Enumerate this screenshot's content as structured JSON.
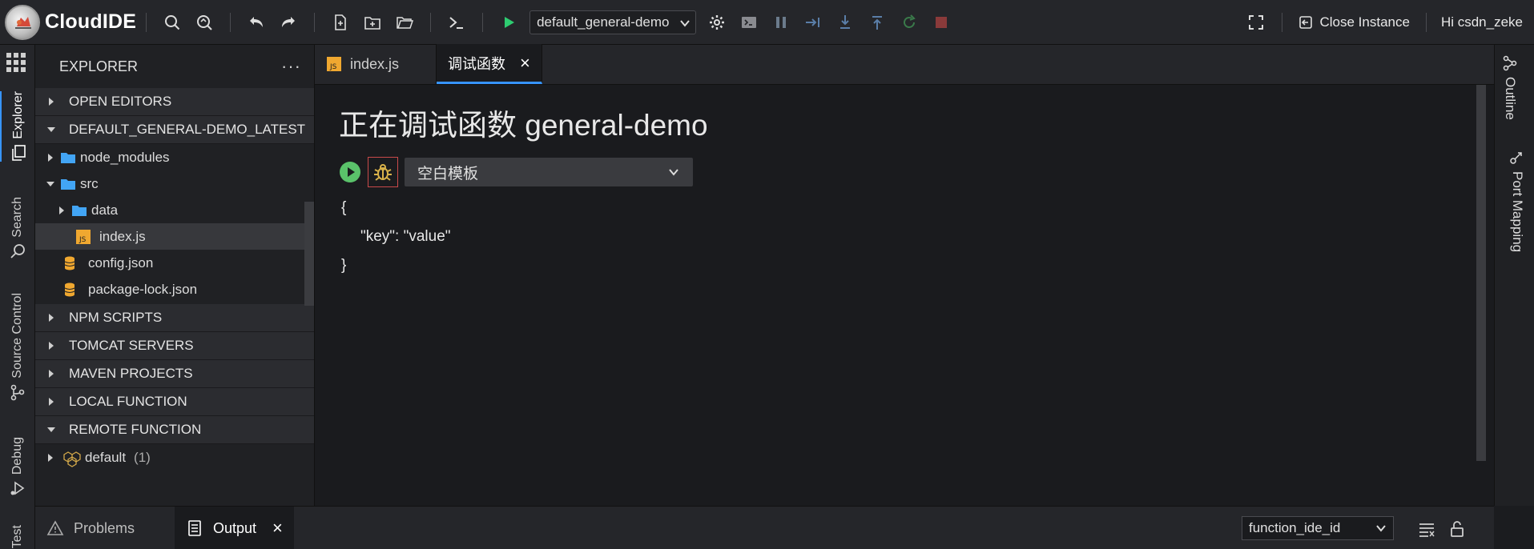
{
  "app": {
    "name": "CloudIDE"
  },
  "toolbar": {
    "launch_config": "default_general-demo",
    "close_instance": "Close Instance",
    "greeting": "Hi csdn_zeke"
  },
  "activity_bar": {
    "items": [
      {
        "label": "Explorer"
      },
      {
        "label": "Search"
      },
      {
        "label": "Source Control"
      },
      {
        "label": "Debug"
      },
      {
        "label": "Test"
      }
    ]
  },
  "explorer": {
    "title": "EXPLORER",
    "more": "···",
    "sections": {
      "open_editors": "OPEN EDITORS",
      "project": "DEFAULT_GENERAL-DEMO_LATEST",
      "npm": "NPM SCRIPTS",
      "tomcat": "TOMCAT SERVERS",
      "maven": "MAVEN PROJECTS",
      "local_function": "LOCAL FUNCTION",
      "remote_function": "REMOTE FUNCTION"
    },
    "tree": {
      "node_modules": "node_modules",
      "src": "src",
      "data": "data",
      "index_js": "index.js",
      "config_json": "config.json",
      "package_lock": "package-lock.json"
    },
    "remote": {
      "name": "default",
      "count": "(1)"
    }
  },
  "tabs": [
    {
      "label": "index.js"
    },
    {
      "label": "调试函数",
      "close": "×"
    }
  ],
  "editor": {
    "title": "正在调试函数 general-demo",
    "template": "空白模板",
    "json_lines": [
      "{",
      "\"key\": \"value\"",
      "}"
    ]
  },
  "right_rail": {
    "outline": "Outline",
    "port_mapping": "Port Mapping"
  },
  "bottom_panel": {
    "problems": "Problems",
    "output": "Output",
    "output_close": "×",
    "output_source": "function_ide_id"
  },
  "colors": {
    "accent": "#3794ff",
    "run_green": "#2ecc71",
    "folder_blue": "#42a5f5",
    "js_badge": "#f0a830",
    "debug_border": "#c94a4a"
  }
}
